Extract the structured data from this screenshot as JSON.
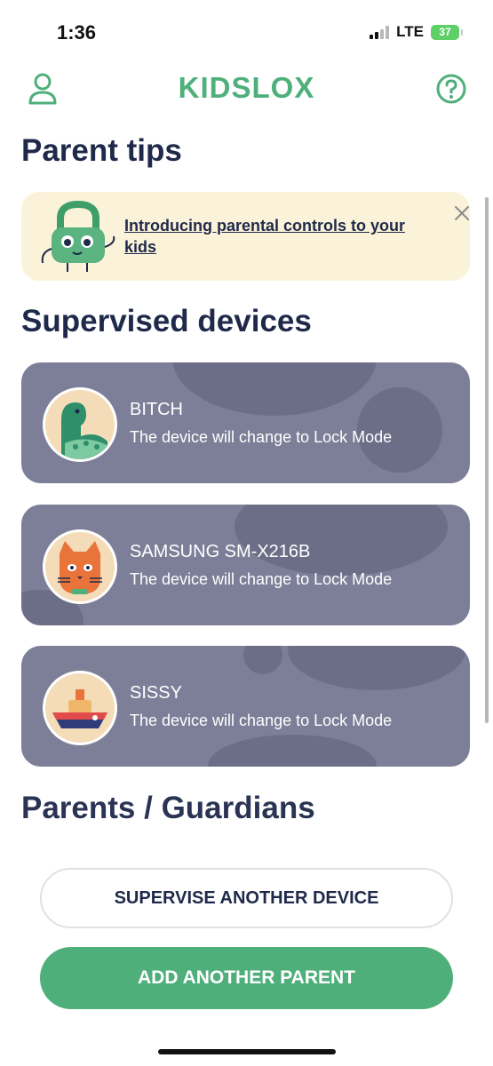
{
  "status_bar": {
    "time": "1:36",
    "network": "LTE",
    "battery": "37"
  },
  "header": {
    "logo": "KIDSLOX",
    "user_icon": "user-icon",
    "help_icon": "help-circle-icon"
  },
  "colors": {
    "brand_green": "#4faf7b",
    "card_bg": "#7d7f98",
    "banner_bg": "#fbf3d9",
    "text_dark": "#1f2a4a"
  },
  "parent_tips": {
    "title": "Parent tips",
    "banner": {
      "text": "Introducing parental controls to your kids",
      "close_icon": "close-icon"
    }
  },
  "supervised_devices": {
    "title": "Supervised devices",
    "devices": [
      {
        "name": "BITCH",
        "status": "The device will change to Lock Mode",
        "avatar_icon": "dinosaur-avatar-icon"
      },
      {
        "name": "SAMSUNG SM-X216B",
        "status": "The device will change to Lock Mode",
        "avatar_icon": "cat-avatar-icon"
      },
      {
        "name": "SISSY",
        "status": "The device will change to Lock Mode",
        "avatar_icon": "boat-avatar-icon"
      }
    ]
  },
  "parents": {
    "title": "Parents / Guardians"
  },
  "actions": {
    "supervise_label": "SUPERVISE ANOTHER DEVICE",
    "add_parent_label": "ADD ANOTHER PARENT"
  }
}
